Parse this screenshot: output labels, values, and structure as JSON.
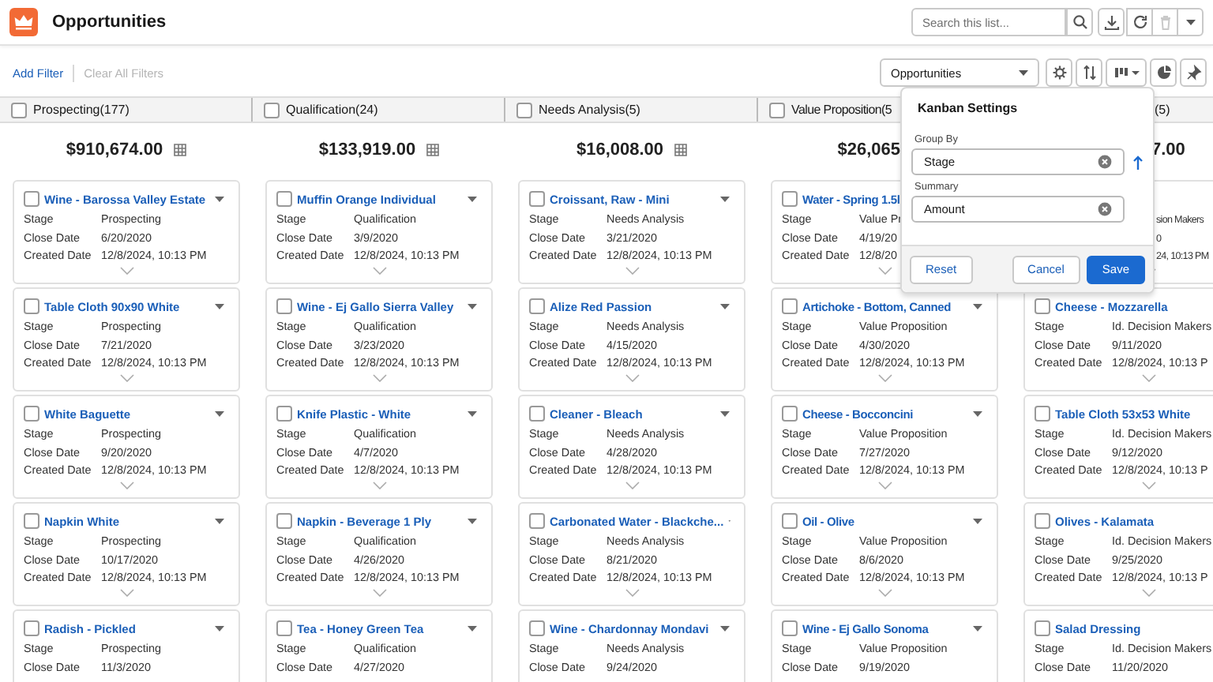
{
  "header": {
    "title": "Opportunities"
  },
  "search": {
    "placeholder": "Search this list..."
  },
  "actions": [
    {
      "kind": "download",
      "disabled": false
    },
    {
      "kind": "refresh",
      "disabled": false
    },
    {
      "kind": "delete",
      "disabled": true
    },
    {
      "kind": "more",
      "disabled": false
    }
  ],
  "filters": {
    "add": "Add Filter",
    "clear": "Clear All Filters",
    "clear_disabled": true
  },
  "list_view": {
    "value": "Opportunities"
  },
  "view_buttons": [
    {
      "kind": "settings"
    },
    {
      "kind": "sort"
    },
    {
      "kind": "kanban"
    },
    {
      "kind": "chart"
    },
    {
      "kind": "pin"
    }
  ],
  "columns": [
    {
      "title": "Prospecting(177)",
      "checked": false,
      "summary": "$910,674.00",
      "cards": [
        {
          "title": "Wine - Barossa Valley Estate",
          "checked": false,
          "menu": true,
          "fields": [
            {
              "label": "Stage",
              "value": "Prospecting"
            },
            {
              "label": "Close Date",
              "value": "6/20/2020"
            },
            {
              "label": "Created Date",
              "value": "12/8/2024, 10:13 PM"
            }
          ]
        },
        {
          "title": "Table Cloth 90x90 White",
          "checked": false,
          "menu": true,
          "fields": [
            {
              "label": "Stage",
              "value": "Prospecting"
            },
            {
              "label": "Close Date",
              "value": "7/21/2020"
            },
            {
              "label": "Created Date",
              "value": "12/8/2024, 10:13 PM"
            }
          ]
        },
        {
          "title": "White Baguette",
          "checked": false,
          "menu": true,
          "fields": [
            {
              "label": "Stage",
              "value": "Prospecting"
            },
            {
              "label": "Close Date",
              "value": "9/20/2020"
            },
            {
              "label": "Created Date",
              "value": "12/8/2024, 10:13 PM"
            }
          ]
        },
        {
          "title": "Napkin White",
          "checked": false,
          "menu": true,
          "fields": [
            {
              "label": "Stage",
              "value": "Prospecting"
            },
            {
              "label": "Close Date",
              "value": "10/17/2020"
            },
            {
              "label": "Created Date",
              "value": "12/8/2024, 10:13 PM"
            }
          ]
        },
        {
          "title": "Radish - Pickled",
          "checked": false,
          "menu": true,
          "fields": [
            {
              "label": "Stage",
              "value": "Prospecting"
            },
            {
              "label": "Close Date",
              "value": "11/3/2020"
            }
          ]
        }
      ]
    },
    {
      "title": "Qualification(24)",
      "checked": false,
      "summary": "$133,919.00",
      "cards": [
        {
          "title": "Muffin Orange Individual",
          "checked": false,
          "menu": true,
          "fields": [
            {
              "label": "Stage",
              "value": "Qualification"
            },
            {
              "label": "Close Date",
              "value": "3/9/2020"
            },
            {
              "label": "Created Date",
              "value": "12/8/2024, 10:13 PM"
            }
          ]
        },
        {
          "title": "Wine - Ej Gallo Sierra Valley",
          "checked": false,
          "menu": true,
          "fields": [
            {
              "label": "Stage",
              "value": "Qualification"
            },
            {
              "label": "Close Date",
              "value": "3/23/2020"
            },
            {
              "label": "Created Date",
              "value": "12/8/2024, 10:13 PM"
            }
          ]
        },
        {
          "title": "Knife Plastic - White",
          "checked": false,
          "menu": true,
          "fields": [
            {
              "label": "Stage",
              "value": "Qualification"
            },
            {
              "label": "Close Date",
              "value": "4/7/2020"
            },
            {
              "label": "Created Date",
              "value": "12/8/2024, 10:13 PM"
            }
          ]
        },
        {
          "title": "Napkin - Beverage 1 Ply",
          "checked": false,
          "menu": true,
          "fields": [
            {
              "label": "Stage",
              "value": "Qualification"
            },
            {
              "label": "Close Date",
              "value": "4/26/2020"
            },
            {
              "label": "Created Date",
              "value": "12/8/2024, 10:13 PM"
            }
          ]
        },
        {
          "title": "Tea - Honey Green Tea",
          "checked": false,
          "menu": true,
          "fields": [
            {
              "label": "Stage",
              "value": "Qualification"
            },
            {
              "label": "Close Date",
              "value": "4/27/2020"
            }
          ]
        }
      ]
    },
    {
      "title": "Needs Analysis(5)",
      "checked": false,
      "summary": "$16,008.00",
      "cards": [
        {
          "title": "Croissant, Raw - Mini",
          "checked": false,
          "menu": true,
          "fields": [
            {
              "label": "Stage",
              "value": "Needs Analysis"
            },
            {
              "label": "Close Date",
              "value": "3/21/2020"
            },
            {
              "label": "Created Date",
              "value": "12/8/2024, 10:13 PM"
            }
          ]
        },
        {
          "title": "Alize Red Passion",
          "checked": false,
          "menu": true,
          "fields": [
            {
              "label": "Stage",
              "value": "Needs Analysis"
            },
            {
              "label": "Close Date",
              "value": "4/15/2020"
            },
            {
              "label": "Created Date",
              "value": "12/8/2024, 10:13 PM"
            }
          ]
        },
        {
          "title": "Cleaner - Bleach",
          "checked": false,
          "menu": true,
          "fields": [
            {
              "label": "Stage",
              "value": "Needs Analysis"
            },
            {
              "label": "Close Date",
              "value": "4/28/2020"
            },
            {
              "label": "Created Date",
              "value": "12/8/2024, 10:13 PM"
            }
          ]
        },
        {
          "title": "Carbonated Water - Blackche...",
          "checked": false,
          "menu": true,
          "fields": [
            {
              "label": "Stage",
              "value": "Needs Analysis"
            },
            {
              "label": "Close Date",
              "value": "8/21/2020"
            },
            {
              "label": "Created Date",
              "value": "12/8/2024, 10:13 PM"
            }
          ]
        },
        {
          "title": "Wine - Chardonnay Mondavi",
          "checked": false,
          "menu": true,
          "fields": [
            {
              "label": "Stage",
              "value": "Needs Analysis"
            },
            {
              "label": "Close Date",
              "value": "9/24/2020"
            }
          ]
        }
      ]
    },
    {
      "title": "Value Proposition(5",
      "checked": false,
      "summary": "$26,065",
      "cut_right": true,
      "cards": [
        {
          "title": "Water - Spring 1.5l",
          "checked": false,
          "menu": false,
          "cut_right": true,
          "fields": [
            {
              "label": "Stage",
              "value": "Value Pr"
            },
            {
              "label": "Close Date",
              "value": "4/19/20"
            },
            {
              "label": "Created Date",
              "value": "12/8/20"
            }
          ]
        },
        {
          "title": "Artichoke - Bottom, Canned",
          "checked": false,
          "menu": true,
          "fields": [
            {
              "label": "Stage",
              "value": "Value Proposition"
            },
            {
              "label": "Close Date",
              "value": "4/30/2020"
            },
            {
              "label": "Created Date",
              "value": "12/8/2024, 10:13 PM"
            }
          ]
        },
        {
          "title": "Cheese - Bocconcini",
          "checked": false,
          "menu": true,
          "fields": [
            {
              "label": "Stage",
              "value": "Value Proposition"
            },
            {
              "label": "Close Date",
              "value": "7/27/2020"
            },
            {
              "label": "Created Date",
              "value": "12/8/2024, 10:13 PM"
            }
          ]
        },
        {
          "title": "Oil - Olive",
          "checked": false,
          "menu": true,
          "fields": [
            {
              "label": "Stage",
              "value": "Value Proposition"
            },
            {
              "label": "Close Date",
              "value": "8/6/2020"
            },
            {
              "label": "Created Date",
              "value": "12/8/2024, 10:13 PM"
            }
          ]
        },
        {
          "title": "Wine - Ej Gallo Sonoma",
          "checked": false,
          "menu": true,
          "fields": [
            {
              "label": "Stage",
              "value": "Value Proposition"
            },
            {
              "label": "Close Date",
              "value": "9/19/2020"
            }
          ]
        }
      ]
    },
    {
      "title": "(5)",
      "summary": "7.00",
      "cut_left": true,
      "cards": [
        {
          "menu": false,
          "cut_left": true,
          "fields": [
            {
              "value": "sion Makers"
            },
            {
              "value": "0"
            },
            {
              "value": "24, 10:13 PM"
            }
          ]
        },
        {
          "title": "Cheese - Mozzarella",
          "checked": false,
          "menu": false,
          "fields": [
            {
              "label": "Stage",
              "value": "Id. Decision Makers"
            },
            {
              "label": "Close Date",
              "value": "9/11/2020"
            },
            {
              "label": "Created Date",
              "value": "12/8/2024, 10:13 P"
            }
          ]
        },
        {
          "title": "Table Cloth 53x53 White",
          "checked": false,
          "menu": false,
          "fields": [
            {
              "label": "Stage",
              "value": "Id. Decision Makers"
            },
            {
              "label": "Close Date",
              "value": "9/12/2020"
            },
            {
              "label": "Created Date",
              "value": "12/8/2024, 10:13 P"
            }
          ]
        },
        {
          "title": "Olives - Kalamata",
          "checked": false,
          "menu": false,
          "fields": [
            {
              "label": "Stage",
              "value": "Id. Decision Makers"
            },
            {
              "label": "Close Date",
              "value": "9/25/2020"
            },
            {
              "label": "Created Date",
              "value": "12/8/2024, 10:13 P"
            }
          ]
        },
        {
          "title": "Salad Dressing",
          "checked": false,
          "menu": false,
          "fields": [
            {
              "label": "Stage",
              "value": "Id. Decision Makers"
            },
            {
              "label": "Close Date",
              "value": "11/20/2020"
            }
          ]
        }
      ]
    }
  ],
  "popover": {
    "title": "Kanban Settings",
    "group_by": {
      "label": "Group By",
      "value": "Stage"
    },
    "summary": {
      "label": "Summary",
      "value": "Amount"
    },
    "buttons": [
      {
        "label": "Reset",
        "kind": "neutral"
      },
      {
        "label": "Cancel",
        "kind": "neutral"
      },
      {
        "label": "Save",
        "kind": "brand"
      }
    ]
  }
}
